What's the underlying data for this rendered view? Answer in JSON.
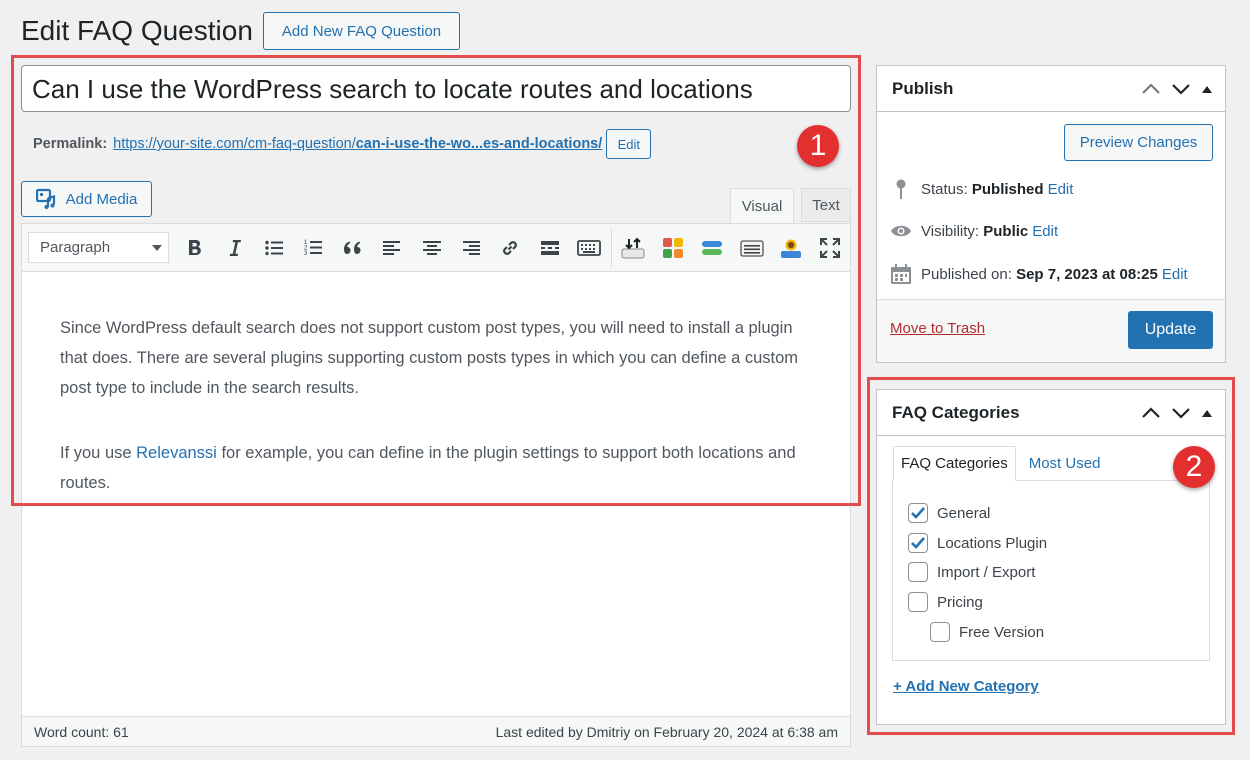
{
  "page": {
    "title": "Edit FAQ Question",
    "add_new_label": "Add New FAQ Question"
  },
  "post": {
    "title": "Can I use the WordPress search to locate routes and locations",
    "permalink_label": "Permalink:",
    "permalink_base": "https://your-site.com/cm-faq-question/",
    "permalink_slug": "can-i-use-the-wo...es-and-locations/",
    "permalink_edit": "Edit"
  },
  "editor": {
    "add_media": "Add Media",
    "tabs": {
      "visual": "Visual",
      "text": "Text"
    },
    "format": "Paragraph",
    "p1": "Since WordPress default search does not support custom post types, you will need to install a plugin that does. There are several plugins supporting custom posts types in which you can define a custom post type to include in the search results.",
    "p2_before": "If you use ",
    "p2_link": "Relevanssi",
    "p2_after": " for example, you can define in the plugin settings to support both locations and routes.",
    "word_count": "Word count: 61",
    "last_edited": "Last edited by Dmitriy on February 20, 2024 at 6:38 am"
  },
  "annotations": {
    "one": "1",
    "two": "2"
  },
  "publish": {
    "title": "Publish",
    "preview": "Preview Changes",
    "status_label": "Status:",
    "status_value": "Published",
    "visibility_label": "Visibility:",
    "visibility_value": "Public",
    "published_label": "Published on:",
    "published_value": "Sep 7, 2023 at 08:25",
    "edit": "Edit",
    "trash": "Move to Trash",
    "update": "Update"
  },
  "categories": {
    "title": "FAQ Categories",
    "tab_all": "FAQ Categories",
    "tab_used": "Most Used",
    "items": [
      {
        "label": "General",
        "checked": true
      },
      {
        "label": "Locations Plugin",
        "checked": true
      },
      {
        "label": "Import / Export",
        "checked": false
      },
      {
        "label": "Pricing",
        "checked": false
      },
      {
        "label": "Free Version",
        "checked": false
      }
    ],
    "add_new": "+ Add New Category"
  },
  "colors": {
    "accent": "#2271b1",
    "annotation": "#e3302f",
    "danger": "#b32d2e"
  }
}
